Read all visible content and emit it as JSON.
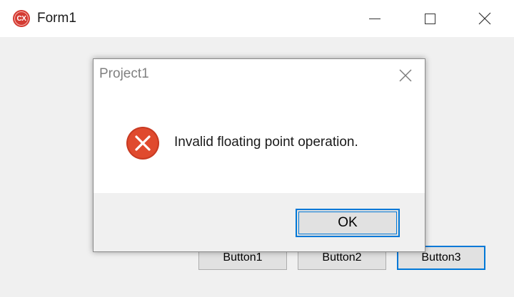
{
  "window": {
    "title": "Form1",
    "icon_label": "CX",
    "icon_color": "#d43b33"
  },
  "form": {
    "buttons": [
      {
        "label": "Button1"
      },
      {
        "label": "Button2"
      },
      {
        "label": "Button3"
      }
    ]
  },
  "dialog": {
    "title": "Project1",
    "message": "Invalid floating point operation.",
    "icon": "error-icon",
    "icon_color": "#e04a2e",
    "ok_label": "OK"
  },
  "colors": {
    "focus_accent": "#0078d7",
    "button_face": "#e1e1e1",
    "form_background": "#f0f0f0"
  }
}
